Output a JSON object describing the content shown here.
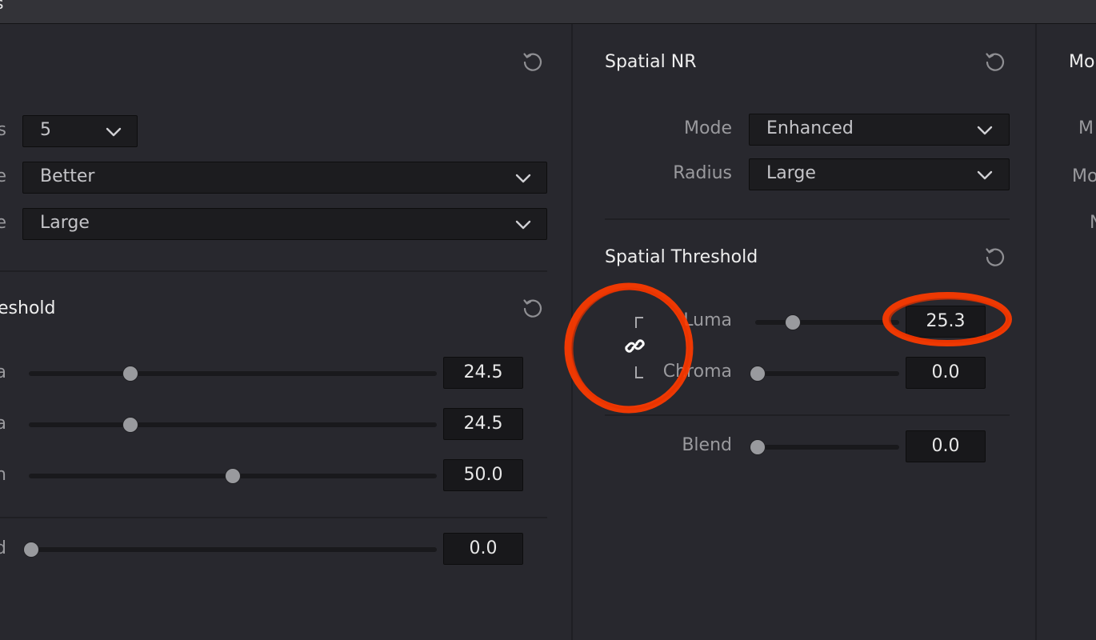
{
  "header": {
    "title_fragment": "s"
  },
  "left_panel": {
    "fields": [
      {
        "label": "s",
        "value": "5"
      },
      {
        "label": "e",
        "value": "Better"
      },
      {
        "label": "e",
        "value": "Large"
      }
    ],
    "threshold": {
      "title": "eshold",
      "sliders": [
        {
          "label": "a",
          "value": "24.5",
          "level": 0.25
        },
        {
          "label": "a",
          "value": "24.5",
          "level": 0.25
        },
        {
          "label": "n",
          "value": "50.0",
          "level": 0.5
        }
      ]
    },
    "blend": {
      "label": "d",
      "value": "0.0",
      "level": 0.0
    }
  },
  "middle_panel": {
    "title": "Spatial NR",
    "mode": {
      "label": "Mode",
      "value": "Enhanced"
    },
    "radius": {
      "label": "Radius",
      "value": "Large"
    },
    "threshold": {
      "title": "Spatial Threshold",
      "luma": {
        "label": "Luma",
        "value": "25.3",
        "level": 0.26
      },
      "chroma": {
        "label": "Chroma",
        "value": "0.0",
        "level": 0.0
      }
    },
    "blend": {
      "label": "Blend",
      "value": "0.0",
      "level": 0.0
    }
  },
  "right_panel": {
    "title": "Mo",
    "labels": [
      "M",
      "Mo",
      "N"
    ]
  },
  "icons": {
    "reset": "reset-icon",
    "chevron": "chevron-down-icon",
    "link": "link-icon"
  },
  "colors": {
    "annotation": "#ff3b00",
    "panel_bg": "#28282e"
  }
}
